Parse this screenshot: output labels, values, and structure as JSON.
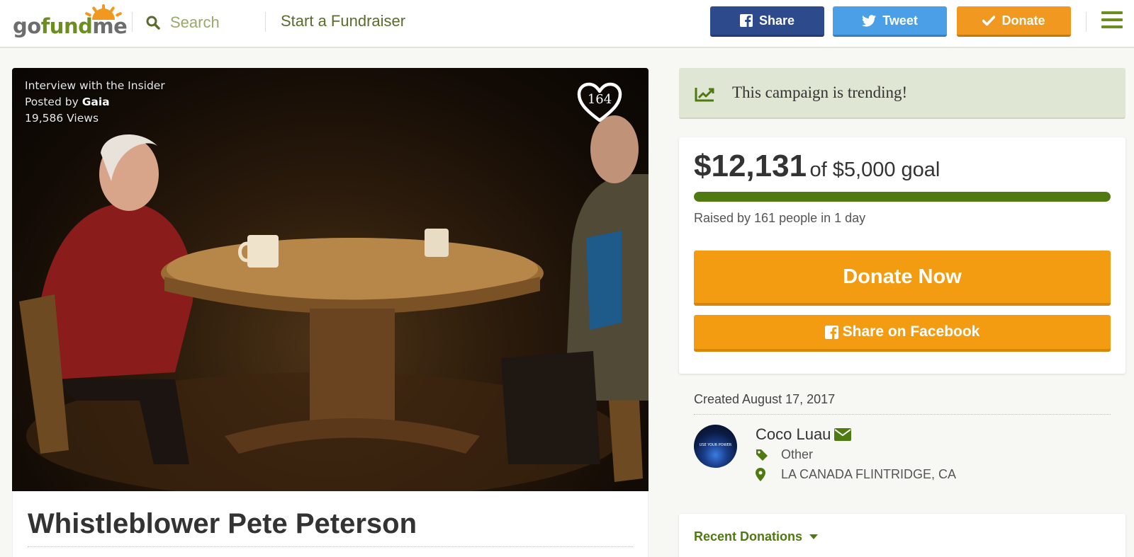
{
  "header": {
    "logo": "gofundme",
    "search_placeholder": "Search",
    "start_link": "Start a Fundraiser",
    "share_label": "Share",
    "tweet_label": "Tweet",
    "donate_label": "Donate",
    "colors": {
      "share": "#2d4a8c",
      "tweet": "#4a9fe6",
      "donate": "#f0981f",
      "brand_green": "#6b8e1e"
    }
  },
  "video": {
    "title": "Interview with the Insider",
    "posted_by_prefix": "Posted by",
    "posted_by": "Gaia",
    "views": "19,586 Views",
    "heart_count": "164"
  },
  "campaign": {
    "title": "Whistleblower Pete Peterson"
  },
  "trending": {
    "text": "This campaign is trending!",
    "icon": "trending-chart-icon"
  },
  "goal": {
    "raised": "$12,131",
    "of_goal": "of $5,000 goal",
    "progress_fraction": 1.0,
    "raised_by": "Raised by 161 people in 1 day",
    "donate_now_label": "Donate Now",
    "share_facebook_label": "Share on Facebook"
  },
  "details": {
    "created": "Created August 17, 2017",
    "organizer": "Coco Luau",
    "avatar_text": "USE YOUR POWER",
    "category": "Other",
    "location": "LA CANADA FLINTRIDGE, CA"
  },
  "recent": {
    "title": "Recent Donations"
  }
}
